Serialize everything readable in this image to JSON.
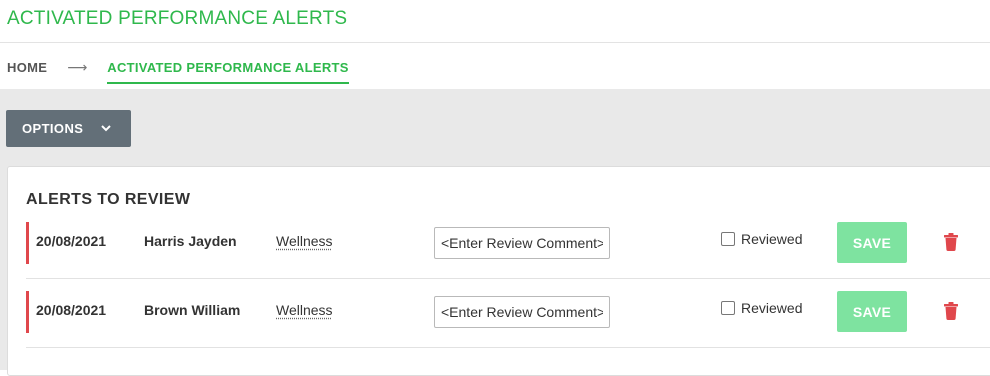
{
  "page": {
    "title": "ACTIVATED PERFORMANCE ALERTS"
  },
  "breadcrumb": {
    "home": "HOME",
    "separator": "⟶",
    "current": "ACTIVATED PERFORMANCE ALERTS"
  },
  "options": {
    "label": "OPTIONS",
    "icon": "chevron-down-icon"
  },
  "alerts": {
    "title": "ALERTS TO REVIEW",
    "rows": [
      {
        "date": "20/08/2021",
        "name": "Harris Jayden",
        "category": "Wellness",
        "comment_value": "<Enter Review Comment>",
        "reviewed_label": "Reviewed",
        "reviewed": false,
        "save_label": "SAVE"
      },
      {
        "date": "20/08/2021",
        "name": "Brown William",
        "category": "Wellness",
        "comment_value": "<Enter Review Comment>",
        "reviewed_label": "Reviewed",
        "reviewed": false,
        "save_label": "SAVE"
      }
    ]
  },
  "colors": {
    "brand_green": "#2fb84c",
    "save_green": "#7ee3a0",
    "alert_red": "#e0474c",
    "options_bg": "#636f78"
  }
}
